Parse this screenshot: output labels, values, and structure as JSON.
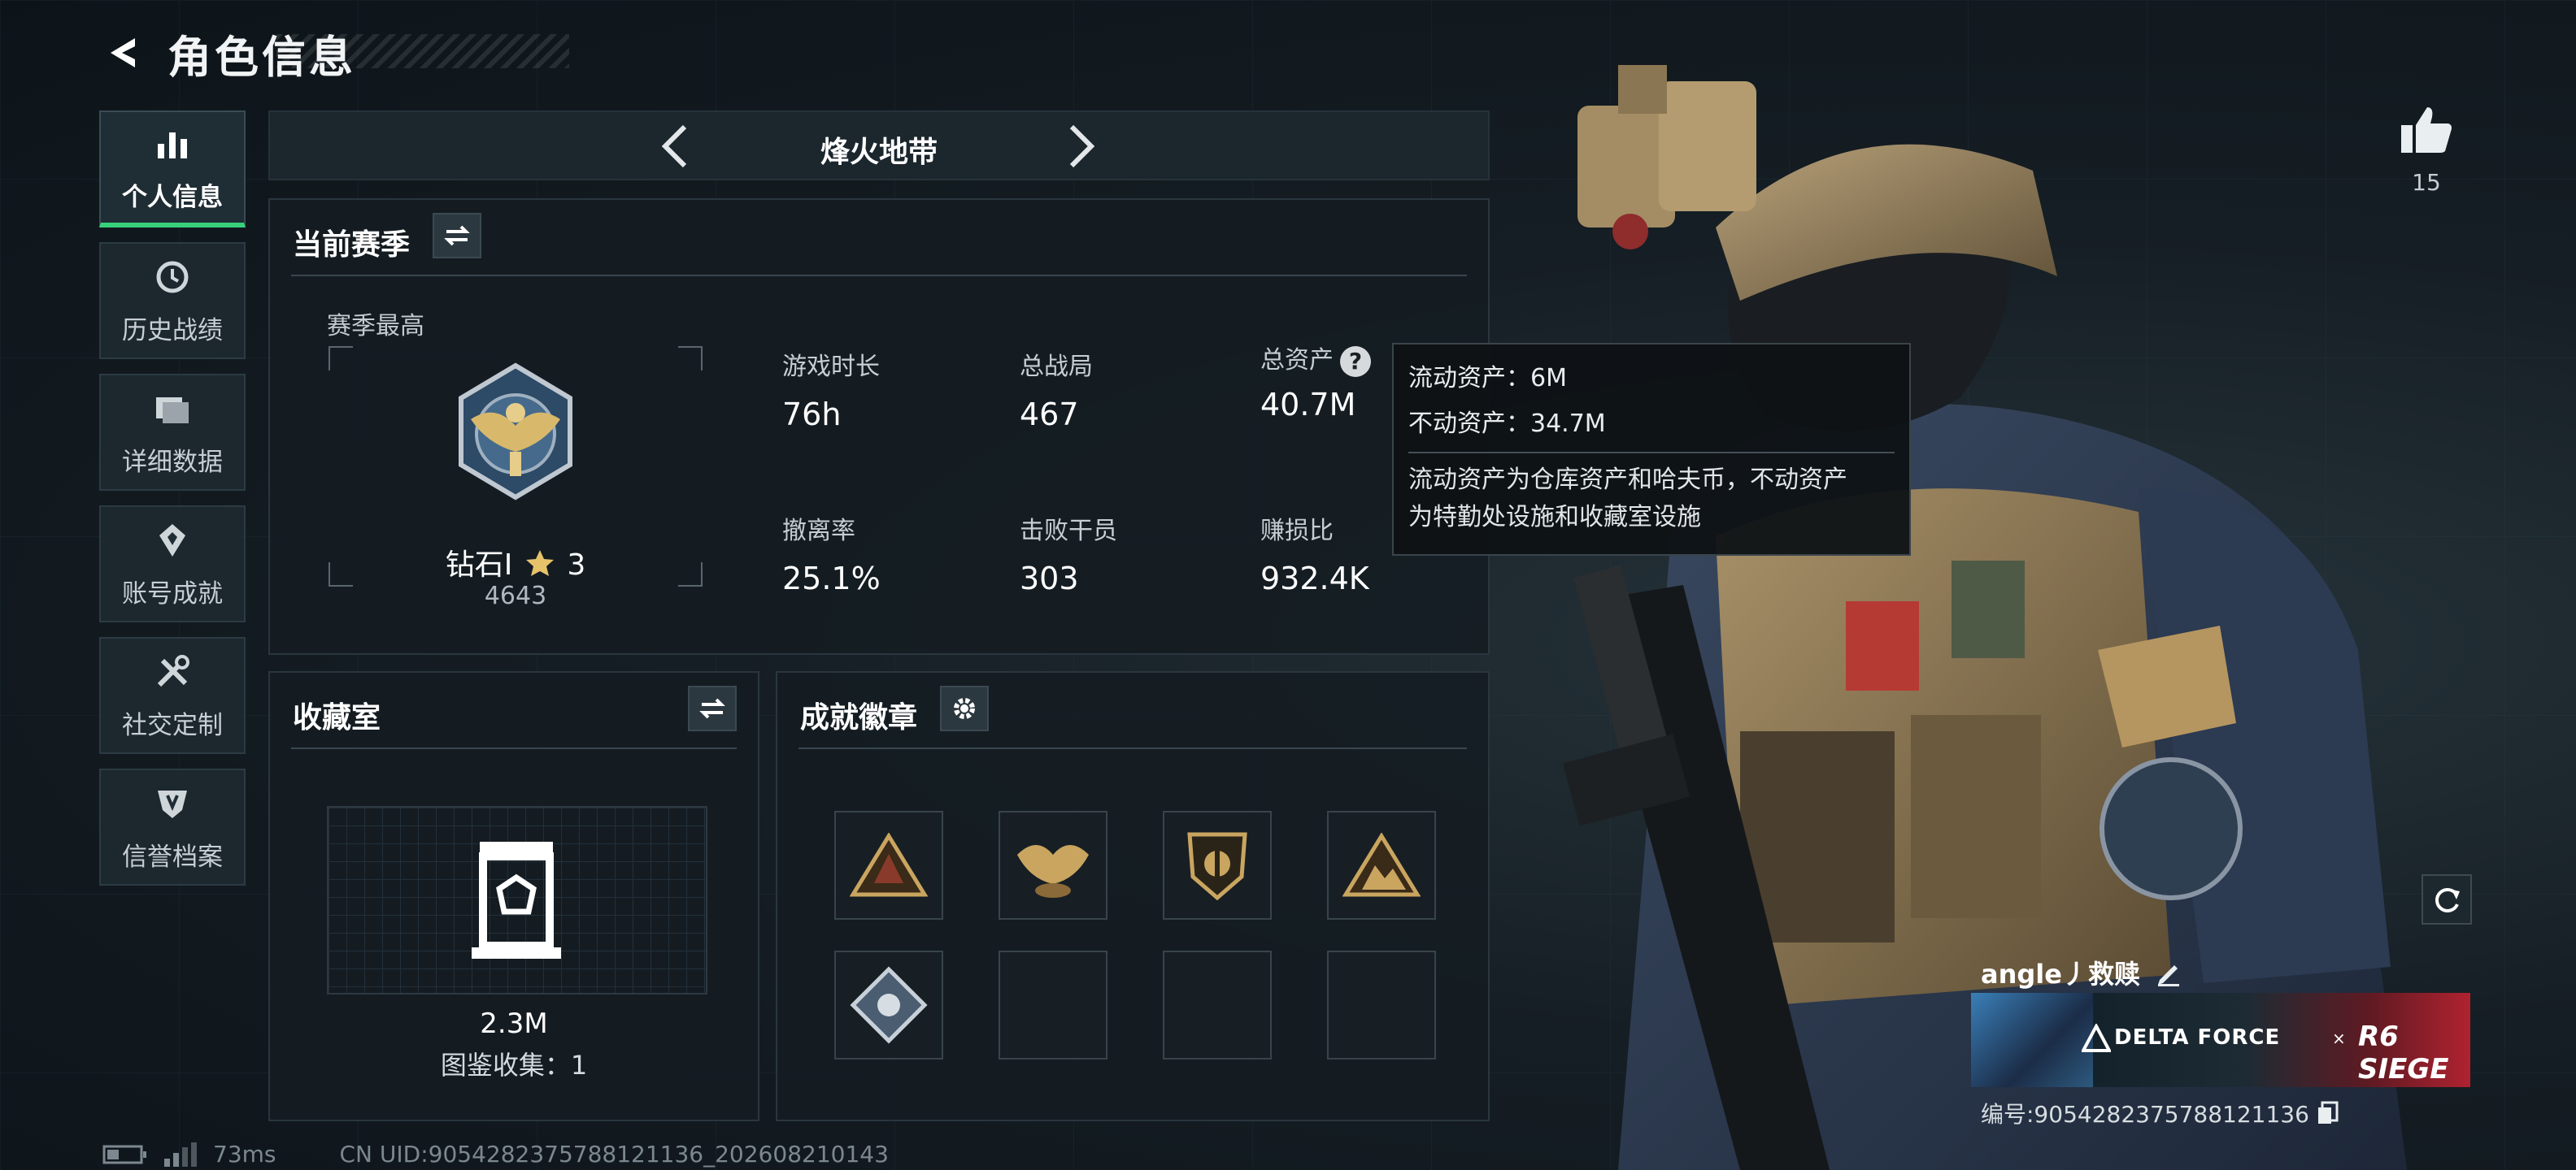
{
  "header": {
    "title": "角色信息"
  },
  "sidebar": {
    "items": [
      {
        "label": "个人信息",
        "icon": "bar-chart-icon",
        "active": true
      },
      {
        "label": "历史战绩",
        "icon": "clock-icon"
      },
      {
        "label": "详细数据",
        "icon": "folder-icon"
      },
      {
        "label": "账号成就",
        "icon": "medal-icon"
      },
      {
        "label": "社交定制",
        "icon": "tools-icon"
      },
      {
        "label": "信誉档案",
        "icon": "shield-icon"
      }
    ]
  },
  "mode": {
    "name": "烽火地带"
  },
  "season": {
    "title": "当前赛季",
    "subtitle": "赛季最高",
    "rank_name": "钻石I",
    "rank_stars": "3",
    "rank_score": "4643",
    "stats": [
      {
        "label": "游戏时长",
        "value": "76h"
      },
      {
        "label": "总战局",
        "value": "467"
      },
      {
        "label": "总资产",
        "value": "40.7M"
      },
      {
        "label": "撤离率",
        "value": "25.1%"
      },
      {
        "label": "击败干员",
        "value": "303"
      },
      {
        "label": "赚损比",
        "value": "932.4K"
      }
    ],
    "help_mark": "?"
  },
  "tooltip": {
    "liquid": "流动资产：6M",
    "fixed": "不动资产：34.7M",
    "desc_line1": "流动资产为仓库资产和哈夫币，不动资产",
    "desc_line2": "为特勤处设施和收藏室设施"
  },
  "collection": {
    "title": "收藏室",
    "value": "2.3M",
    "count": "图鉴收集：1"
  },
  "badges": {
    "title": "成就徽章",
    "slots": [
      "triangle-badge-icon",
      "eagle-badge-icon",
      "shield-badge-icon",
      "mountain-badge-icon",
      "diamond-badge-icon",
      "",
      "",
      ""
    ]
  },
  "like": {
    "count": "15"
  },
  "player": {
    "name": "angle丿救赎",
    "id": "编号:9054282375788121136",
    "banner_left": "DELTA FORCE",
    "banner_x": "×",
    "banner_right": "R6 SIEGE"
  },
  "footer": {
    "ping": "73ms",
    "uid": "CN UID:9054282375788121136_202608210143"
  },
  "colors": {
    "accent": "#37d17b",
    "panel": "#141d22",
    "gold": "#c9a560"
  }
}
